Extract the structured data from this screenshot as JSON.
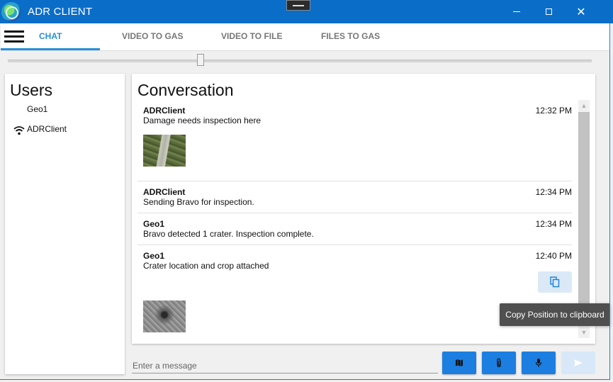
{
  "window": {
    "title": "ADR CLIENT",
    "accent_color": "#0a6ec9"
  },
  "tabs": [
    {
      "label": "CHAT",
      "active": true
    },
    {
      "label": "VIDEO TO GAS"
    },
    {
      "label": "VIDEO TO FILE"
    },
    {
      "label": "FILES TO GAS"
    }
  ],
  "slider": {
    "value_fraction": 0.33
  },
  "users": {
    "heading": "Users",
    "items": [
      {
        "name": "Geo1",
        "icon": "none"
      },
      {
        "name": "ADRClient",
        "icon": "wifi-icon"
      }
    ]
  },
  "conversation": {
    "heading": "Conversation",
    "messages": [
      {
        "sender": "ADRClient",
        "text": "Damage needs inspection here",
        "time": "12:32 PM",
        "attachment": "road-image"
      },
      {
        "sender": "ADRClient",
        "text": "Sending Bravo for inspection.",
        "time": "12:34 PM"
      },
      {
        "sender": "Geo1",
        "text": "Bravo detected 1 crater. Inspection complete.",
        "time": "12:34 PM"
      },
      {
        "sender": "Geo1",
        "text": "Crater location and crop attached",
        "time": "12:40 PM",
        "attachment": "crater-image"
      }
    ]
  },
  "tooltip": {
    "text": "Copy Position to clipboard"
  },
  "composer": {
    "placeholder": "Enter a message",
    "buttons": [
      "map-icon",
      "paperclip-icon",
      "microphone-icon",
      "send-icon"
    ]
  }
}
